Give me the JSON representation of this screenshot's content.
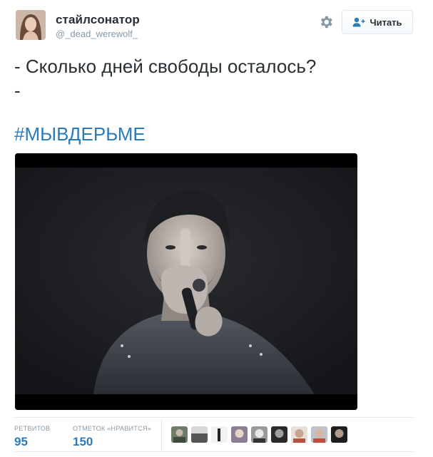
{
  "tweet": {
    "author": {
      "display_name": "стайлсонатор",
      "username": "@_dead_werewolf_",
      "avatar_icon": "avatar-photo"
    },
    "actions": {
      "settings_icon": "gear-icon",
      "follow_label": "Читать",
      "follow_icon": "person-add-icon"
    },
    "text_lines": [
      "- Сколько дней свободы осталось?",
      "-"
    ],
    "hashtag": "#МЫВДЕРЬМЕ",
    "media": {
      "type": "photo"
    },
    "stats": {
      "retweets_label": "РЕТВИТОВ",
      "retweets_value": "95",
      "likes_label": "ОТМЕТОК «НРАВИТСЯ»",
      "likes_value": "150"
    },
    "likers_count_shown": 9
  },
  "colors": {
    "link": "#2b7bb9",
    "text": "#292f33",
    "muted": "#8899a6",
    "border": "#e1e8ed"
  }
}
